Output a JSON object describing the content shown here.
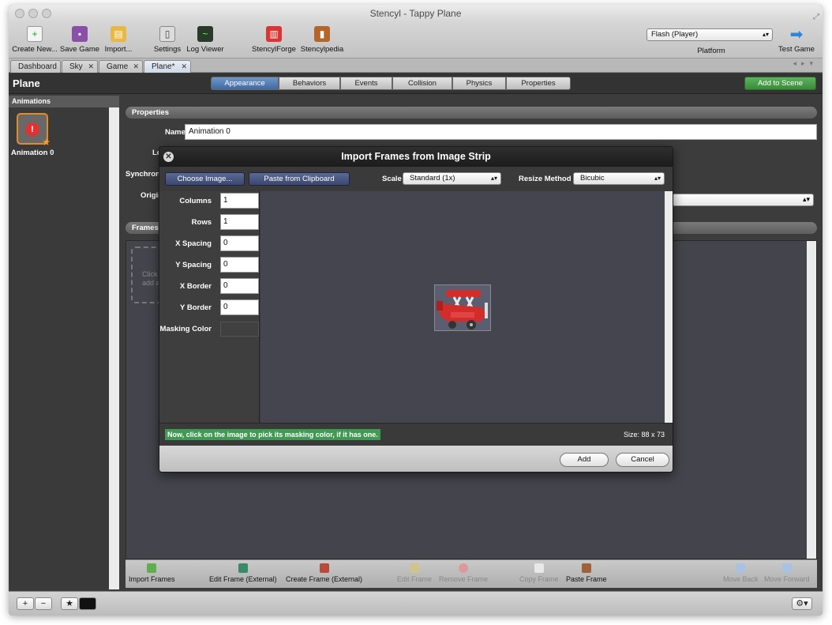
{
  "window": {
    "title": "Stencyl - Tappy Plane"
  },
  "toolbar": {
    "items": [
      {
        "label": "Create New...",
        "icon": "plus-icon"
      },
      {
        "label": "Save Game",
        "icon": "floppy-icon"
      },
      {
        "label": "Import...",
        "icon": "import-icon"
      },
      {
        "label": "Settings",
        "icon": "settings-icon"
      },
      {
        "label": "Log Viewer",
        "icon": "log-icon"
      },
      {
        "label": "StencylForge",
        "icon": "store-icon"
      },
      {
        "label": "Stencylpedia",
        "icon": "book-icon"
      }
    ],
    "platform_label": "Platform",
    "platform_value": "Flash (Player)",
    "test_game_label": "Test Game"
  },
  "tabs": [
    {
      "label": "Dashboard"
    },
    {
      "label": "Sky"
    },
    {
      "label": "Game"
    },
    {
      "label": "Plane*"
    }
  ],
  "header": {
    "title": "Plane",
    "segments": [
      "Appearance",
      "Behaviors",
      "Events",
      "Collision",
      "Physics",
      "Properties"
    ],
    "add_to_scene": "Add to Scene"
  },
  "animations": {
    "heading": "Animations",
    "items": [
      {
        "label": "Animation 0"
      }
    ]
  },
  "properties": {
    "heading": "Properties",
    "name_label": "Name",
    "name_value": "Animation 0",
    "loop_label": "Loop",
    "sync_label": "Synchron",
    "origin_label": "Origin I"
  },
  "frames": {
    "heading": "Frames",
    "dropzone_text": [
      "Click",
      "add a"
    ],
    "toolbar": [
      {
        "label": "Import Frames",
        "enabled": true
      },
      {
        "label": "Edit Frame (External)",
        "enabled": true
      },
      {
        "label": "Create Frame (External)",
        "enabled": true
      },
      {
        "label": "Edit Frame",
        "enabled": false
      },
      {
        "label": "Remove Frame",
        "enabled": false
      },
      {
        "label": "Copy Frame",
        "enabled": false
      },
      {
        "label": "Paste Frame",
        "enabled": true
      },
      {
        "label": "Move Back",
        "enabled": false
      },
      {
        "label": "Move Forward",
        "enabled": false
      }
    ]
  },
  "bottombar": {
    "add": "+",
    "remove": "−",
    "star": "★",
    "gear": "⚙▾"
  },
  "dialog": {
    "title": "Import Frames from Image Strip",
    "choose_image": "Choose Image...",
    "paste_clipboard": "Paste from Clipboard",
    "scale_label": "Scale",
    "scale_value": "Standard (1x)",
    "resize_label": "Resize Method",
    "resize_value": "Bicubic",
    "fields": [
      {
        "label": "Columns",
        "value": "1"
      },
      {
        "label": "Rows",
        "value": "1"
      },
      {
        "label": "X Spacing",
        "value": "0"
      },
      {
        "label": "Y Spacing",
        "value": "0"
      },
      {
        "label": "X Border",
        "value": "0"
      },
      {
        "label": "Y Border",
        "value": "0"
      }
    ],
    "masking_label": "Masking Color",
    "hint": "Now, click on the image to pick its masking color, if it has one.",
    "size": "Size: 88 x 73",
    "add": "Add",
    "cancel": "Cancel"
  },
  "colors": {
    "accent": "#3f6aa5",
    "green": "#3f9a52",
    "orange": "#e28b2a"
  }
}
